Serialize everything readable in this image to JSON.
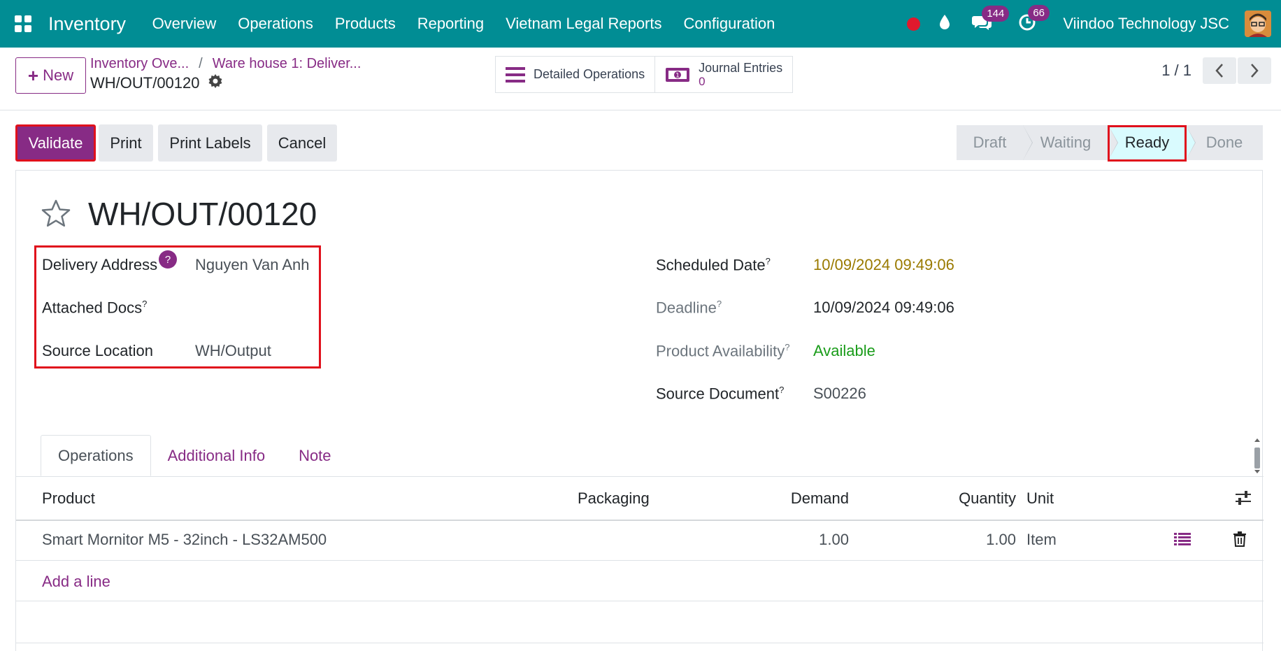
{
  "navbar": {
    "app_name": "Inventory",
    "menu": [
      "Overview",
      "Operations",
      "Products",
      "Reporting",
      "Vietnam Legal Reports",
      "Configuration"
    ],
    "chat_count": "144",
    "activity_count": "66",
    "company": "Viindoo Technology JSC"
  },
  "control": {
    "new_label": "New",
    "breadcrumb": [
      "Inventory Ove...",
      "Ware house 1: Deliver..."
    ],
    "breadcrumb_sep": "/",
    "record_ref": "WH/OUT/00120",
    "detailed_ops_label": "Detailed Operations",
    "journal_label": "Journal Entries",
    "journal_count": "0",
    "pager": "1 / 1"
  },
  "statusbar": {
    "buttons": [
      "Validate",
      "Print",
      "Print Labels",
      "Cancel"
    ],
    "stages": [
      "Draft",
      "Waiting",
      "Ready",
      "Done"
    ],
    "current_stage": "Ready"
  },
  "form": {
    "title": "WH/OUT/00120",
    "left_fields": [
      {
        "label": "Delivery Address",
        "value": "Nguyen Van Anh"
      },
      {
        "label": "Attached Docs",
        "sup": "?",
        "value": ""
      },
      {
        "label": "Source Location",
        "value": "WH/Output"
      }
    ],
    "help_badge": "?",
    "right_fields": [
      {
        "label": "Scheduled Date",
        "sup": "?",
        "value": "10/09/2024 09:49:06",
        "value_color": "#9a7a00"
      },
      {
        "label": "Deadline",
        "sup": "?",
        "value": "10/09/2024 09:49:06"
      },
      {
        "label": "Product Availability",
        "sup": "?",
        "value": "Available",
        "value_color": "#1a9c1a"
      },
      {
        "label": "Source Document",
        "sup": "?",
        "value": "S00226"
      }
    ]
  },
  "tabs": [
    "Operations",
    "Additional Info",
    "Note"
  ],
  "table": {
    "headers": {
      "product": "Product",
      "packaging": "Packaging",
      "demand": "Demand",
      "quantity": "Quantity",
      "unit": "Unit"
    },
    "rows": [
      {
        "product": "Smart Mornitor M5 - 32inch - LS32AM500",
        "packaging": "",
        "demand": "1.00",
        "quantity": "1.00",
        "unit": "Item"
      }
    ],
    "add_line": "Add a line"
  },
  "colors": {
    "brand": "#018d94",
    "accent": "#872b85",
    "highlight": "#e0101c"
  }
}
